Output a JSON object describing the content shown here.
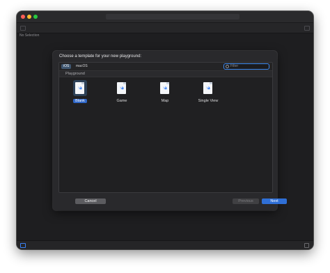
{
  "sidebar": {
    "empty_label": "No Selection"
  },
  "dialog": {
    "title": "Choose a template for your new playground:",
    "platform_tabs": [
      {
        "label": "iOS",
        "selected": true
      },
      {
        "label": "macOS",
        "selected": false
      }
    ],
    "filter": {
      "placeholder": "Filter",
      "value": "",
      "icon": "filter-icon"
    },
    "section_title": "Playground",
    "templates": [
      {
        "label": "Blank",
        "selected": true,
        "icon": "swift-playground-icon"
      },
      {
        "label": "Game",
        "selected": false,
        "icon": "swift-playground-icon"
      },
      {
        "label": "Map",
        "selected": false,
        "icon": "swift-playground-icon"
      },
      {
        "label": "Single View",
        "selected": false,
        "icon": "swift-playground-icon"
      }
    ],
    "buttons": {
      "cancel": "Cancel",
      "previous": "Previous",
      "next": "Next"
    }
  },
  "colors": {
    "accent": "#2f6fd6",
    "window_bg": "#1e1e20",
    "sheet_bg": "#29292c",
    "traffic_close": "#ff5f57",
    "traffic_minimize": "#febc2e",
    "traffic_zoom": "#28c840"
  }
}
